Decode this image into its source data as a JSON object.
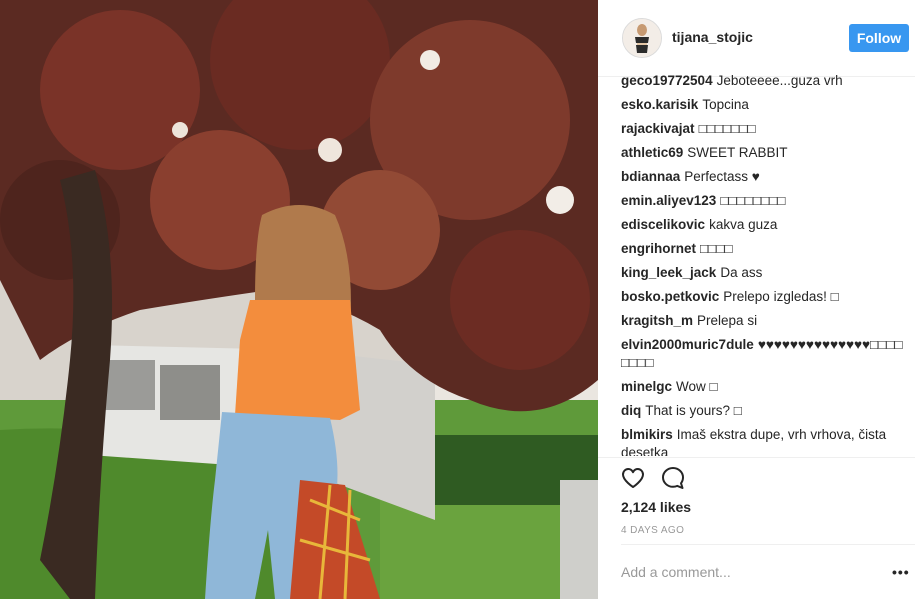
{
  "post": {
    "username": "tijana_stojic",
    "follow_label": "Follow",
    "likes": "2,124 likes",
    "timestamp": "4 DAYS AGO",
    "add_comment_placeholder": "Add a comment...",
    "more_label": "•••"
  },
  "comments": [
    {
      "user": "geco19772504",
      "text": "Jeboteeee...guza vrh"
    },
    {
      "user": "esko.karisik",
      "text": "Topcina"
    },
    {
      "user": "rajackivajat",
      "text": "□□□□□□□"
    },
    {
      "user": "athletic69",
      "text": "SWEET RABBIT"
    },
    {
      "user": "bdiannaa",
      "text": "Perfectass ♥"
    },
    {
      "user": "emin.aliyev123",
      "text": "□□□□□□□□"
    },
    {
      "user": "ediscelikovic",
      "text": "kakva guza"
    },
    {
      "user": "engrihornet",
      "text": "□□□□"
    },
    {
      "user": "king_leek_jack",
      "text": "Da ass"
    },
    {
      "user": "bosko.petkovic",
      "text": "Prelepo izgledas! □"
    },
    {
      "user": "kragitsh_m",
      "text": "Prelepa si"
    },
    {
      "user": "elvin2000muric7dule",
      "text": "♥♥♥♥♥♥♥♥♥♥♥♥♥♥□□□□□□□□"
    },
    {
      "user": "minelgc",
      "text": "Wow □"
    },
    {
      "user": "diq",
      "text": "That is yours? □"
    },
    {
      "user": "blmikirs",
      "text": "Imaš ekstra dupe, vrh vrhova, čista desetka"
    }
  ],
  "icons": {
    "like": "heart-icon",
    "comment": "comment-bubble-icon",
    "options": "more-options-icon"
  },
  "colors": {
    "follow_button": "#3897f0",
    "text": "#262626",
    "muted": "#999999",
    "divider": "#efefef"
  }
}
